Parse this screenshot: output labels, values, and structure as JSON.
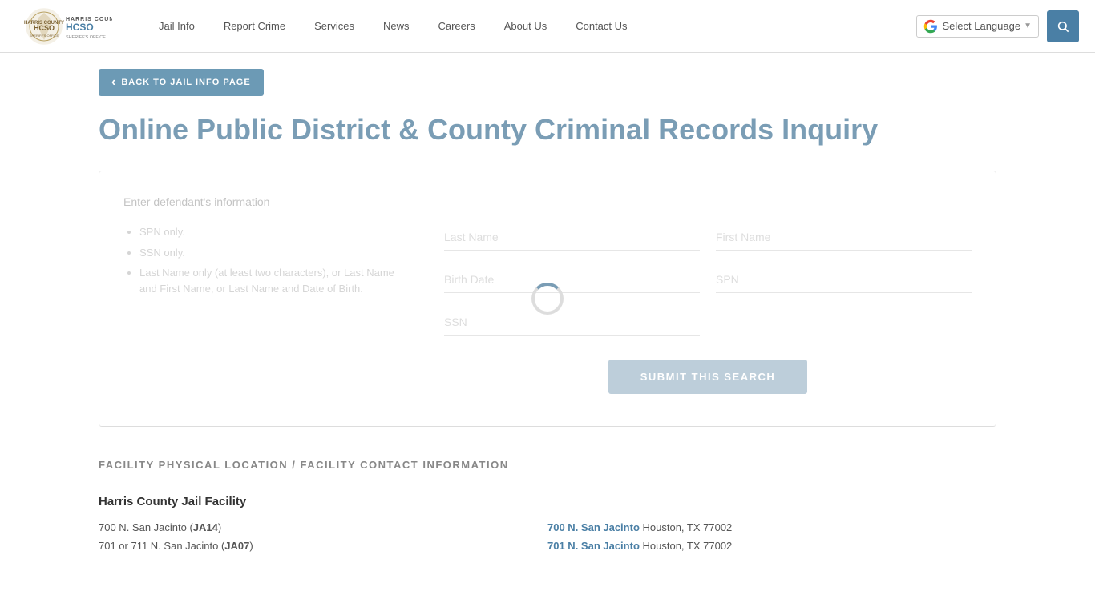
{
  "header": {
    "logo_alt": "Harris County Sheriff's Office",
    "nav_items": [
      {
        "label": "Jail Info",
        "href": "#"
      },
      {
        "label": "Report Crime",
        "href": "#"
      },
      {
        "label": "Services",
        "href": "#"
      },
      {
        "label": "News",
        "href": "#"
      },
      {
        "label": "Careers",
        "href": "#"
      },
      {
        "label": "About Us",
        "href": "#"
      },
      {
        "label": "Contact Us",
        "href": "#"
      }
    ],
    "translate_label": "Select Language",
    "search_icon": "🔍"
  },
  "back_button": "BACK TO JAIL INFO PAGE",
  "page_title": "Online Public District & County Criminal Records Inquiry",
  "form": {
    "instructions_heading": "Enter defendant's information –",
    "instructions": [
      "SPN only.",
      "SSN only.",
      "Last Name only (at least two characters), or Last Name and First Name, or Last Name and Date of Birth."
    ],
    "fields": {
      "last_name_placeholder": "Last Name",
      "first_name_placeholder": "First Name",
      "birth_date_placeholder": "Birth Date",
      "spn_placeholder": "SPN",
      "ssn_placeholder": "SSN"
    },
    "submit_label": "SUBMIT THIS SEARCH"
  },
  "facility": {
    "section_heading": "FACILITY PHYSICAL LOCATION / FACILITY CONTACT INFORMATION",
    "name": "Harris County Jail Facility",
    "addresses": [
      {
        "left_text": "700 N. San Jacinto (",
        "left_code": "JA14",
        "left_close": ")",
        "right_street": "700 N. San Jacinto",
        "right_city": " Houston, TX 77002"
      },
      {
        "left_text": "701 or 711 N. San Jacinto (",
        "left_code": "JA07",
        "left_close": ")",
        "right_street": "701 N. San Jacinto",
        "right_city": " Houston, TX 77002"
      }
    ]
  }
}
